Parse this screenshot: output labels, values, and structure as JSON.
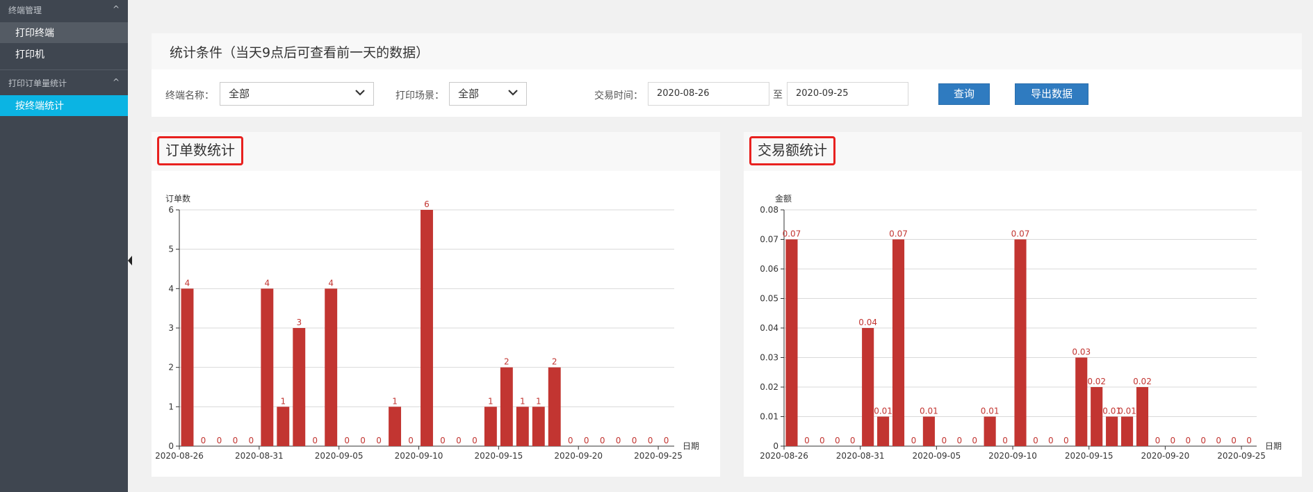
{
  "sidebar": {
    "groups": [
      {
        "label": "终端管理",
        "items": [
          "打印终端",
          "打印机"
        ]
      },
      {
        "label": "打印订单量统计",
        "items": [
          "按终端统计"
        ]
      }
    ],
    "collapse_symbol": "^",
    "active_item": "按终端统计"
  },
  "filter": {
    "title": "统计条件（当天9点后可查看前一天的数据）",
    "terminal_label": "终端名称：",
    "terminal_value": "全部",
    "scene_label": "打印场景：",
    "scene_value": "全部",
    "time_label": "交易时间：",
    "date_from": "2020-08-26",
    "to_label": "至",
    "date_to": "2020-09-25",
    "query_button": "查询",
    "export_button": "导出数据"
  },
  "colors": {
    "bar": "#c23531",
    "accent": "#2f7bc0",
    "active": "#0bb4e3",
    "highlight_border": "#e8211f"
  },
  "chart_data": [
    {
      "type": "bar",
      "title": "订单数统计",
      "ylabel": "订单数",
      "xlabel": "日期",
      "ylim": [
        0,
        6
      ],
      "yticks": [
        "0",
        "1",
        "2",
        "3",
        "4",
        "5",
        "6"
      ],
      "xticks": [
        "2020-08-26",
        "2020-08-31",
        "2020-09-05",
        "2020-09-10",
        "2020-09-15",
        "2020-09-20",
        "2020-09-25"
      ],
      "values": [
        4,
        0,
        0,
        0,
        0,
        4,
        1,
        3,
        0,
        4,
        0,
        0,
        0,
        1,
        0,
        6,
        0,
        0,
        0,
        1,
        2,
        1,
        1,
        2,
        0,
        0,
        0,
        0,
        0,
        0,
        0
      ],
      "labels": [
        "4",
        "0",
        "0",
        "0",
        "0",
        "4",
        "1",
        "3",
        "0",
        "4",
        "0",
        "0",
        "0",
        "1",
        "0",
        "6",
        "0",
        "0",
        "0",
        "1",
        "2",
        "1",
        "1",
        "2",
        "0",
        "0",
        "0",
        "0",
        "0",
        "0",
        "0"
      ],
      "grid": true
    },
    {
      "type": "bar",
      "title": "交易额统计",
      "ylabel": "金额",
      "xlabel": "日期",
      "ylim": [
        0,
        0.08
      ],
      "yticks": [
        "0",
        "0.01",
        "0.02",
        "0.03",
        "0.04",
        "0.05",
        "0.06",
        "0.07",
        "0.08"
      ],
      "xticks": [
        "2020-08-26",
        "2020-08-31",
        "2020-09-05",
        "2020-09-10",
        "2020-09-15",
        "2020-09-20",
        "2020-09-25"
      ],
      "values": [
        0.07,
        0,
        0,
        0,
        0,
        0.04,
        0.01,
        0.07,
        0,
        0.01,
        0,
        0,
        0,
        0.01,
        0,
        0.07,
        0,
        0,
        0,
        0.03,
        0.02,
        0.01,
        0.01,
        0.02,
        0,
        0,
        0,
        0,
        0,
        0,
        0
      ],
      "labels": [
        "0.07",
        "0",
        "0",
        "0",
        "0",
        "0.04",
        "0.01",
        "0.07",
        "0",
        "0.01",
        "0",
        "0",
        "0",
        "0.01",
        "0",
        "0.07",
        "0",
        "0",
        "0",
        "0.03",
        "0.02",
        "0.01",
        "0.01",
        "0.02",
        "0",
        "0",
        "0",
        "0",
        "0",
        "0",
        "0"
      ],
      "grid": true
    }
  ]
}
